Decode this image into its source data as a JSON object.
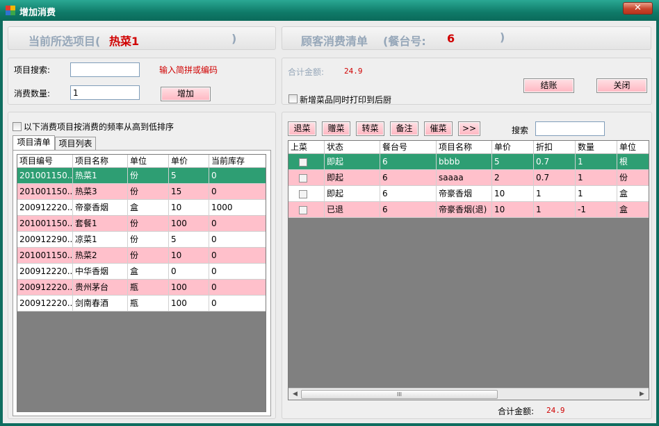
{
  "window": {
    "title": "增加消费",
    "close_glyph": "✕"
  },
  "left_header": {
    "prefix": "当前所选项目(",
    "selected_item": "热菜1",
    "suffix": ")"
  },
  "right_header": {
    "prefix": "顾客消费清单",
    "table_label": "(餐台号:",
    "table_no": "6",
    "suffix": ")"
  },
  "search": {
    "label": "项目搜索:",
    "value": "",
    "hint": "输入简拼或编码"
  },
  "quantity": {
    "label": "消费数量:",
    "value": "1",
    "add_label": "增加"
  },
  "summary": {
    "total_label": "合计金额:",
    "total_value": "24.9",
    "print_label": "新增菜品同时打印到后厨",
    "checkout_label": "结账",
    "close_label": "关闭"
  },
  "sort_option": {
    "label": "以下消费项目按消费的频率从高到低排序"
  },
  "tabs": [
    {
      "label": "项目清单"
    },
    {
      "label": "项目列表"
    }
  ],
  "item_grid": {
    "columns": [
      "项目编号",
      "项目名称",
      "单位",
      "单价",
      "当前库存"
    ],
    "rows": [
      {
        "code": "201001150...",
        "name": "热菜1",
        "unit": "份",
        "price": "5",
        "stock": "0",
        "style": "sel"
      },
      {
        "code": "201001150...",
        "name": "热菜3",
        "unit": "份",
        "price": "15",
        "stock": "0",
        "style": "pink"
      },
      {
        "code": "200912220...",
        "name": "帝豪香烟",
        "unit": "盒",
        "price": "10",
        "stock": "1000",
        "style": "white"
      },
      {
        "code": "201001150...",
        "name": "套餐1",
        "unit": "份",
        "price": "100",
        "stock": "0",
        "style": "pink"
      },
      {
        "code": "200912290...",
        "name": "凉菜1",
        "unit": "份",
        "price": "5",
        "stock": "0",
        "style": "white"
      },
      {
        "code": "201001150...",
        "name": "热菜2",
        "unit": "份",
        "price": "10",
        "stock": "0",
        "style": "pink"
      },
      {
        "code": "200912220...",
        "name": "中华香烟",
        "unit": "盒",
        "price": "0",
        "stock": "0",
        "style": "white"
      },
      {
        "code": "200912220...",
        "name": "贵州茅台",
        "unit": "瓶",
        "price": "100",
        "stock": "0",
        "style": "pink"
      },
      {
        "code": "200912220...",
        "name": "剑南春酒",
        "unit": "瓶",
        "price": "100",
        "stock": "0",
        "style": "white"
      }
    ]
  },
  "order_toolbar": {
    "buttons": [
      "退菜",
      "赠菜",
      "转菜",
      "备注",
      "催菜",
      ">>"
    ],
    "search_label": "搜索",
    "search_value": ""
  },
  "order_grid": {
    "columns": [
      "上菜",
      "状态",
      "餐台号",
      "项目名称",
      "单价",
      "折扣",
      "数量",
      "单位"
    ],
    "rows": [
      {
        "status": "即起",
        "table": "6",
        "name": "bbbb",
        "price": "5",
        "discount": "0.7",
        "qty": "1",
        "unit": "根",
        "style": "sel"
      },
      {
        "status": "即起",
        "table": "6",
        "name": "saaaa",
        "price": "2",
        "discount": "0.7",
        "qty": "1",
        "unit": "份",
        "style": "pink"
      },
      {
        "status": "即起",
        "table": "6",
        "name": "帝豪香烟",
        "price": "10",
        "discount": "1",
        "qty": "1",
        "unit": "盒",
        "style": "white"
      },
      {
        "status": "已退",
        "table": "6",
        "name": "帝豪香烟(退)",
        "price": "10",
        "discount": "1",
        "qty": "-1",
        "unit": "盒",
        "style": "pink"
      }
    ],
    "scroll_glyph": "III"
  },
  "footer": {
    "total_label": "合计金额:",
    "total_value": "24.9"
  },
  "colors": {
    "title_bar": "#0f7a68",
    "selected_row": "#2e9e73",
    "alt_row": "#ffc0cb",
    "button": "#ffb6c1",
    "accent_red": "#d00000",
    "header_text": "#96a7b9"
  },
  "icons": {
    "app": "app-icon",
    "close": "close-icon"
  }
}
